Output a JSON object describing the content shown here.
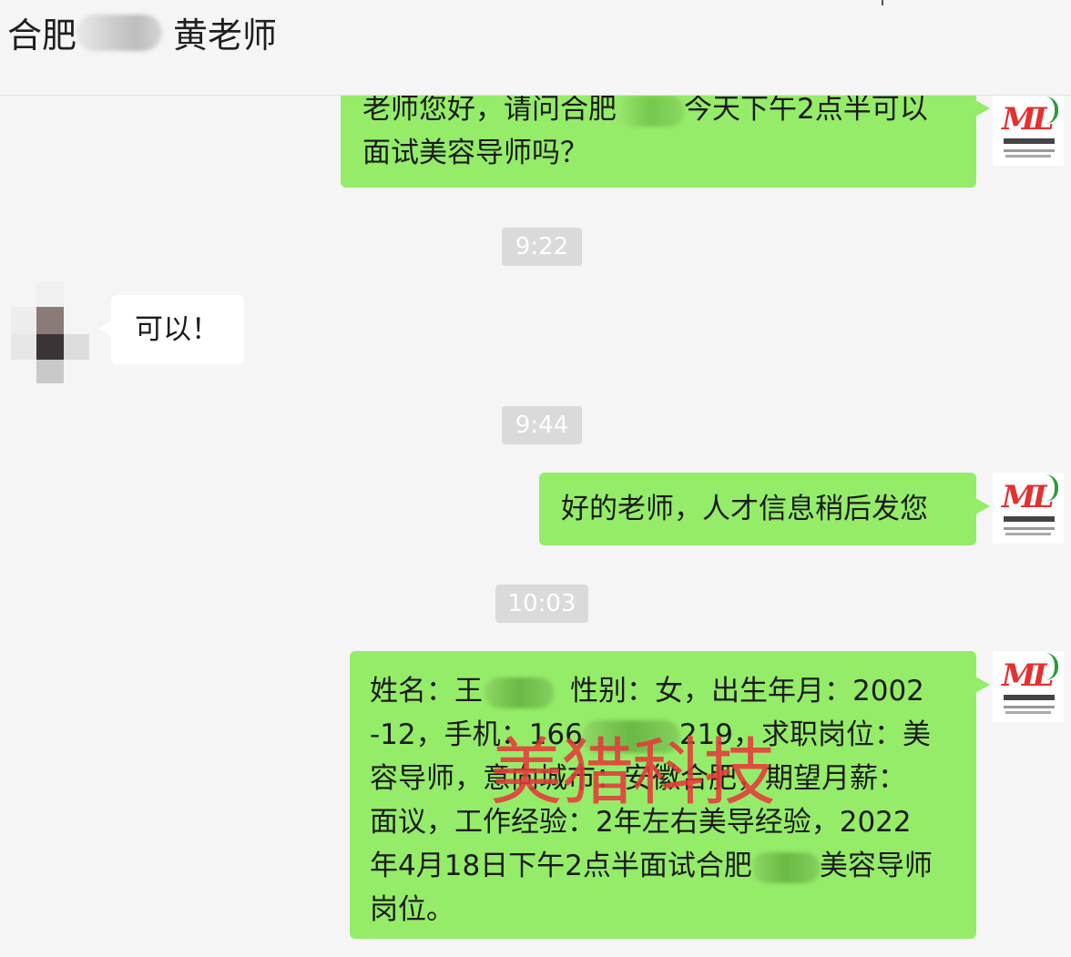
{
  "header": {
    "title_prefix": "合肥",
    "title_suffix": "黄老师"
  },
  "messages": [
    {
      "side": "out",
      "line1_a": "老师您好，请问合肥",
      "line1_b": "今天下午2点半可以",
      "line2": "面试美容导师吗？"
    },
    {
      "time": "9:22"
    },
    {
      "side": "in",
      "text": "可以！"
    },
    {
      "time": "9:44"
    },
    {
      "side": "out",
      "text": "好的老师，人才信息稍后发您"
    },
    {
      "time": "10:03"
    },
    {
      "side": "out",
      "l1_a": "姓名：王",
      "l1_b": "性别：女，出生年月：2002",
      "l2_a": "-12，手机：166",
      "l2_b": "219，求职岗位：美",
      "l3": "容导师，意向城市：安徽合肥，期望月薪：",
      "l4": "面议，工作经验：2年左右美导经验，2022",
      "l5_a": "年4月18日下午2点半面试合肥",
      "l5_b": "美容导师",
      "l6": "岗位。"
    }
  ],
  "watermark": "美猎科技",
  "colors": {
    "outgoing_bubble": "#95ec69",
    "incoming_bubble": "#ffffff",
    "background": "#f5f5f5",
    "time_badge": "#dadada",
    "watermark": "#e63a3a"
  },
  "icons": {
    "self_avatar": "company-logo-icon",
    "contact_avatar": "pixelated-avatar-icon"
  }
}
